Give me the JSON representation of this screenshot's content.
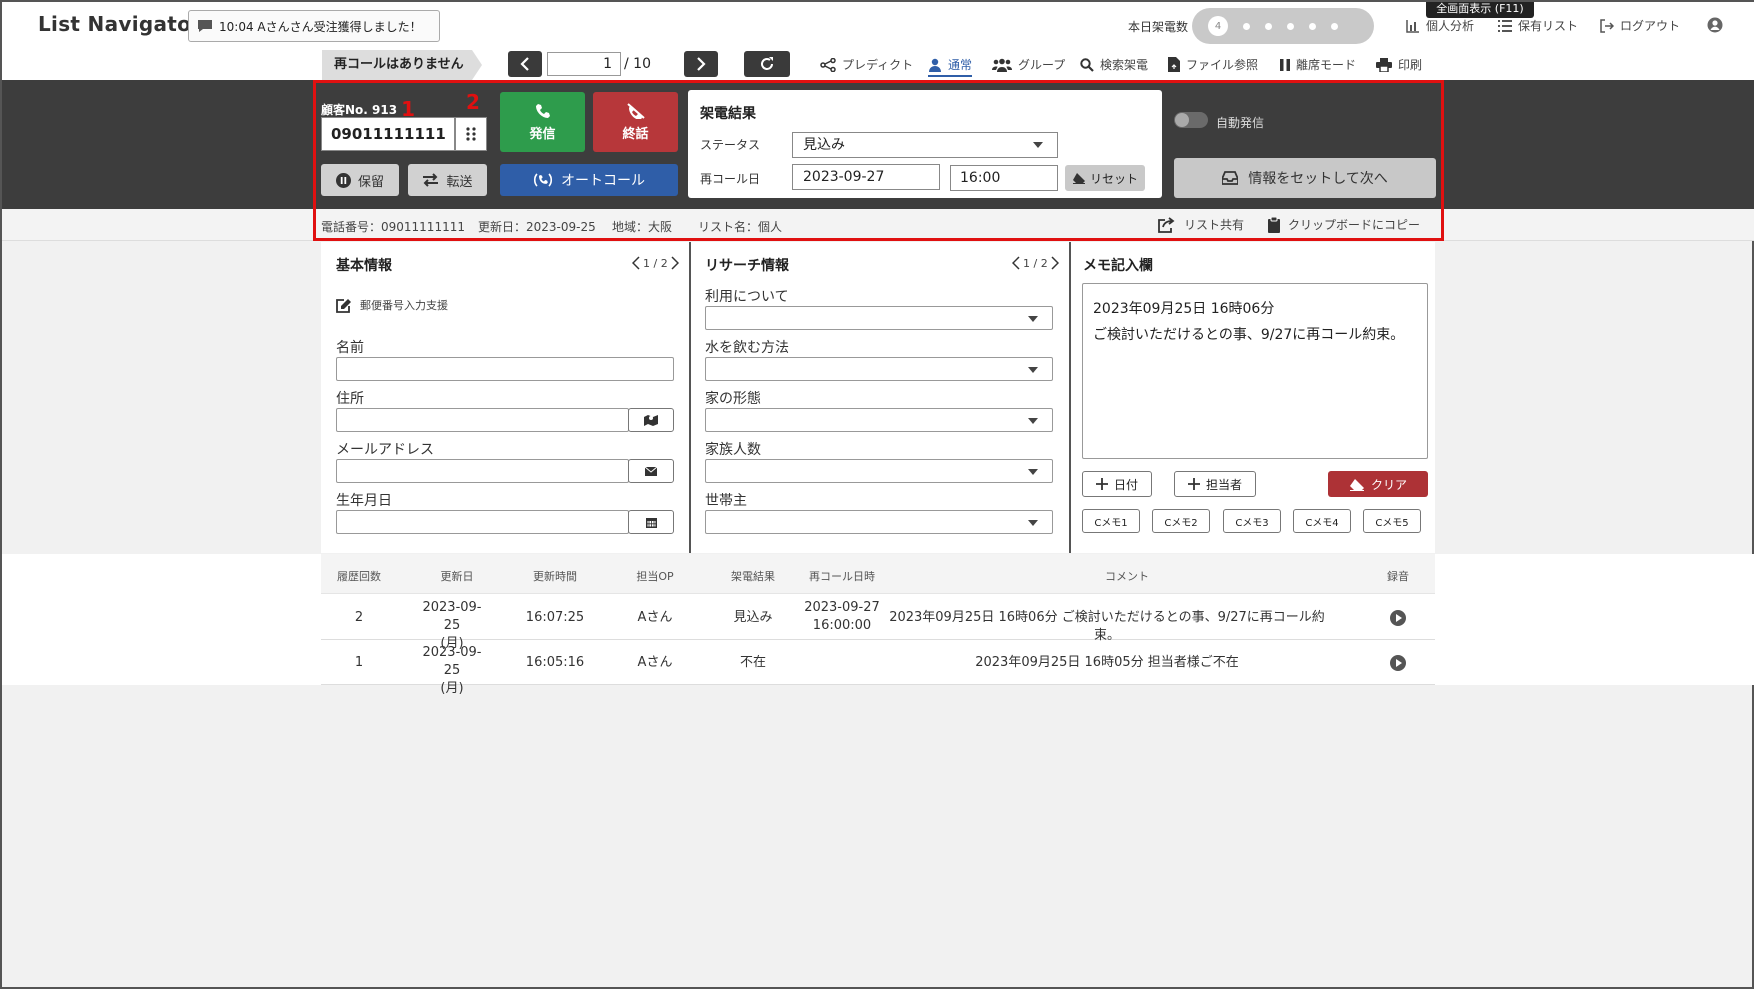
{
  "header": {
    "logo": "List Navigator.",
    "notice": "10:04 Aさんさん受注獲得しました！",
    "call_count_label": "本日架電数",
    "call_count_value": "4",
    "tooltip": "全画面表示 (F11)",
    "nav": [
      {
        "label": "個人分析",
        "icon": "bar-chart-icon"
      },
      {
        "label": "保有リスト",
        "icon": "list-icon"
      },
      {
        "label": "ログアウト",
        "icon": "logout-icon"
      }
    ]
  },
  "toolbar": {
    "recall_notice": "再コールはありません",
    "page_current": "1",
    "page_total": "/ 10",
    "modes": [
      {
        "label": "プレディクト",
        "icon": "share-icon"
      },
      {
        "label": "通常",
        "icon": "user-icon",
        "active": true
      },
      {
        "label": "グループ",
        "icon": "users-icon"
      },
      {
        "label": "検索架電",
        "icon": "search-icon"
      },
      {
        "label": "ファイル参照",
        "icon": "file-icon"
      },
      {
        "label": "離席モード",
        "icon": "pause-icon"
      },
      {
        "label": "印刷",
        "icon": "print-icon"
      }
    ]
  },
  "call_panel": {
    "customer_no": "顧客No. 913",
    "annotation_1": "1",
    "annotation_2": "2",
    "phone_number": "09011111111",
    "dial_label": "発信",
    "hangup_label": "終話",
    "hold_label": "保留",
    "transfer_label": "転送",
    "autocall_label": "オートコール",
    "colors": {
      "dial": "#2e9c4c",
      "hangup": "#b7373a",
      "autocall": "#2f5ea8",
      "annotation": "#e01010"
    }
  },
  "result_panel": {
    "title": "架電結果",
    "status_label": "ステータス",
    "status_value": "見込み",
    "recall_label": "再コール日",
    "recall_date": "2023-09-27",
    "recall_time": "16:00",
    "reset_label": "リセット",
    "auto_dial_label": "自動発信",
    "set_next_label": "情報をセットして次へ"
  },
  "info_strip": {
    "phone": "電話番号：09011111111",
    "updated": "更新日：2023-09-25",
    "region": "地域：大阪",
    "list_name": "リスト名：個人",
    "share_label": "リスト共有",
    "copy_label": "クリップボードにコピー"
  },
  "basic_info": {
    "title": "基本情報",
    "pager": "1 / 2",
    "postal_helper": "郵便番号入力支援",
    "fields": [
      {
        "label": "名前",
        "value": ""
      },
      {
        "label": "住所",
        "value": ""
      },
      {
        "label": "メールアドレス",
        "value": ""
      },
      {
        "label": "生年月日",
        "value": ""
      }
    ]
  },
  "research_info": {
    "title": "リサーチ情報",
    "pager": "1 / 2",
    "fields": [
      {
        "label": "利用について",
        "value": ""
      },
      {
        "label": "水を飲む方法",
        "value": ""
      },
      {
        "label": "家の形態",
        "value": ""
      },
      {
        "label": "家族人数",
        "value": ""
      },
      {
        "label": "世帯主",
        "value": ""
      }
    ]
  },
  "memo": {
    "title": "メモ記入欄",
    "line1": "2023年09月25日 16時06分",
    "line2": "ご検討いただけるとの事、9/27に再コール約束。",
    "date_btn": "日付",
    "operator_btn": "担当者",
    "clear_btn": "クリア",
    "cmemos": [
      "Cメモ1",
      "Cメモ2",
      "Cメモ3",
      "Cメモ4",
      "Cメモ5"
    ]
  },
  "history": {
    "headers": [
      "履歴回数",
      "更新日",
      "更新時間",
      "担当OP",
      "架電結果",
      "再コール日時",
      "コメント",
      "録音"
    ],
    "rows": [
      {
        "count": "2",
        "date": "2023-09-25",
        "weekday": "(月)",
        "time": "16:07:25",
        "op": "Aさん",
        "result": "見込み",
        "recall_date": "2023-09-27",
        "recall_time": "16:00:00",
        "comment": "2023年09月25日 16時06分 ご検討いただけるとの事、9/27に再コール約束。"
      },
      {
        "count": "1",
        "date": "2023-09-25",
        "weekday": "(月)",
        "time": "16:05:16",
        "op": "Aさん",
        "result": "不在",
        "recall_date": "",
        "recall_time": "",
        "comment": "2023年09月25日 16時05分 担当者様ご不在"
      }
    ]
  }
}
